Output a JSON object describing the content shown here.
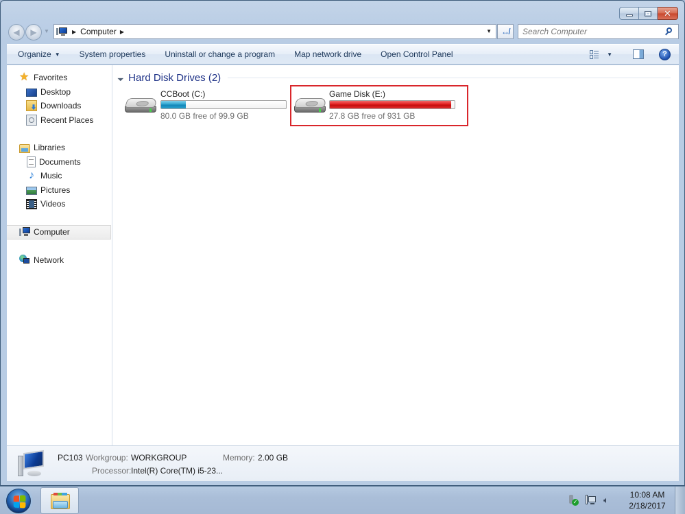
{
  "window": {
    "caption_buttons": {
      "minimize": "minimize",
      "maximize": "maximize",
      "close": "close"
    }
  },
  "navigation": {
    "back_icon": "back-arrow-icon",
    "forward_icon": "forward-arrow-icon",
    "breadcrumb": [
      "Computer"
    ],
    "address_dropdown_icon": "chevron-down-icon",
    "refresh_icon": "refresh-icon",
    "search": {
      "placeholder": "Search Computer",
      "value": ""
    }
  },
  "command_bar": {
    "items": [
      {
        "label": "Organize",
        "has_dropdown": true
      },
      {
        "label": "System properties"
      },
      {
        "label": "Uninstall or change a program"
      },
      {
        "label": "Map network drive"
      },
      {
        "label": "Open Control Panel"
      }
    ],
    "views_icon": "change-view-icon",
    "preview_pane_icon": "preview-pane-icon",
    "help_glyph": "?"
  },
  "sidebar": {
    "favorites": {
      "label": "Favorites",
      "items": [
        {
          "label": "Desktop"
        },
        {
          "label": "Downloads"
        },
        {
          "label": "Recent Places"
        }
      ]
    },
    "libraries": {
      "label": "Libraries",
      "items": [
        {
          "label": "Documents"
        },
        {
          "label": "Music"
        },
        {
          "label": "Pictures"
        },
        {
          "label": "Videos"
        }
      ]
    },
    "computer": {
      "label": "Computer",
      "selected": true
    },
    "network": {
      "label": "Network"
    }
  },
  "main": {
    "group": {
      "title": "Hard Disk Drives (2)",
      "drives": [
        {
          "name": "CCBoot (C:)",
          "free_text": "80.0 GB free of 99.9 GB",
          "used_fraction": 0.199,
          "bar_color": "#1f9ccc",
          "selected": false
        },
        {
          "name": "Game Disk (E:)",
          "free_text": "27.8 GB free of 931 GB",
          "used_fraction": 0.97,
          "bar_color": "#d91515",
          "selected": true,
          "highlight_color": "#d9262b"
        }
      ]
    }
  },
  "details": {
    "computer_name": "PC103",
    "workgroup_label": "Workgroup:",
    "workgroup_value": "WORKGROUP",
    "memory_label": "Memory:",
    "memory_value": "2.00 GB",
    "processor_label": "Processor:",
    "processor_value": "Intel(R) Core(TM) i5-23..."
  },
  "taskbar": {
    "start_icon": "windows-start-icon",
    "pinned": [
      {
        "name": "Windows Explorer",
        "icon": "explorer-folder-icon",
        "active": true
      }
    ],
    "tray_icons": [
      "usb-safely-remove-icon",
      "network-icon",
      "volume-icon"
    ],
    "clock_time": "10:08 AM",
    "clock_date": "2/18/2017"
  }
}
